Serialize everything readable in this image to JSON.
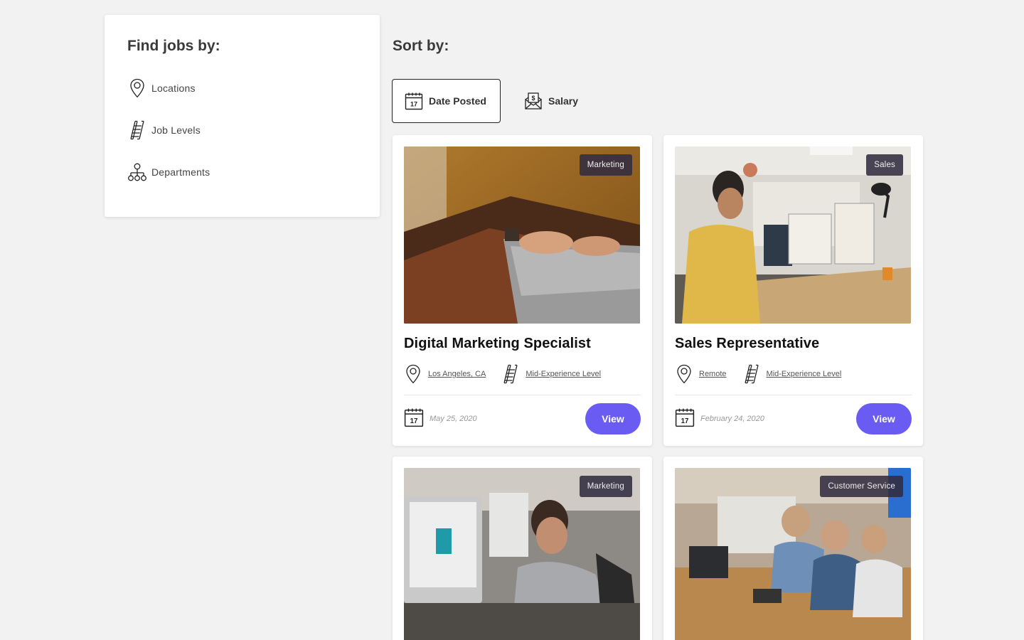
{
  "filters": {
    "heading": "Find jobs by:",
    "items": [
      {
        "label": "Locations",
        "icon": "map-pin-icon"
      },
      {
        "label": "Job Levels",
        "icon": "ladder-icon"
      },
      {
        "label": "Departments",
        "icon": "org-chart-icon"
      }
    ]
  },
  "sort": {
    "heading": "Sort by:",
    "options": [
      {
        "label": "Date Posted",
        "icon": "calendar-icon",
        "icon_text": "17",
        "active": true
      },
      {
        "label": "Salary",
        "icon": "money-envelope-icon",
        "active": false
      }
    ]
  },
  "jobs": [
    {
      "category": "Marketing",
      "title": "Digital Marketing Specialist",
      "location": "Los Angeles, CA",
      "level": "Mid-Experience Level",
      "date": "May 25, 2020",
      "view_label": "View",
      "calendar_day": "17"
    },
    {
      "category": "Sales",
      "title": "Sales Representative",
      "location": "Remote",
      "level": "Mid-Experience Level",
      "date": "February 24, 2020",
      "view_label": "View",
      "calendar_day": "17"
    },
    {
      "category": "Marketing"
    },
    {
      "category": "Customer Service"
    }
  ],
  "colors": {
    "accent": "#6a5cf2",
    "background": "#f2f2f2",
    "badge": "#322c40"
  }
}
